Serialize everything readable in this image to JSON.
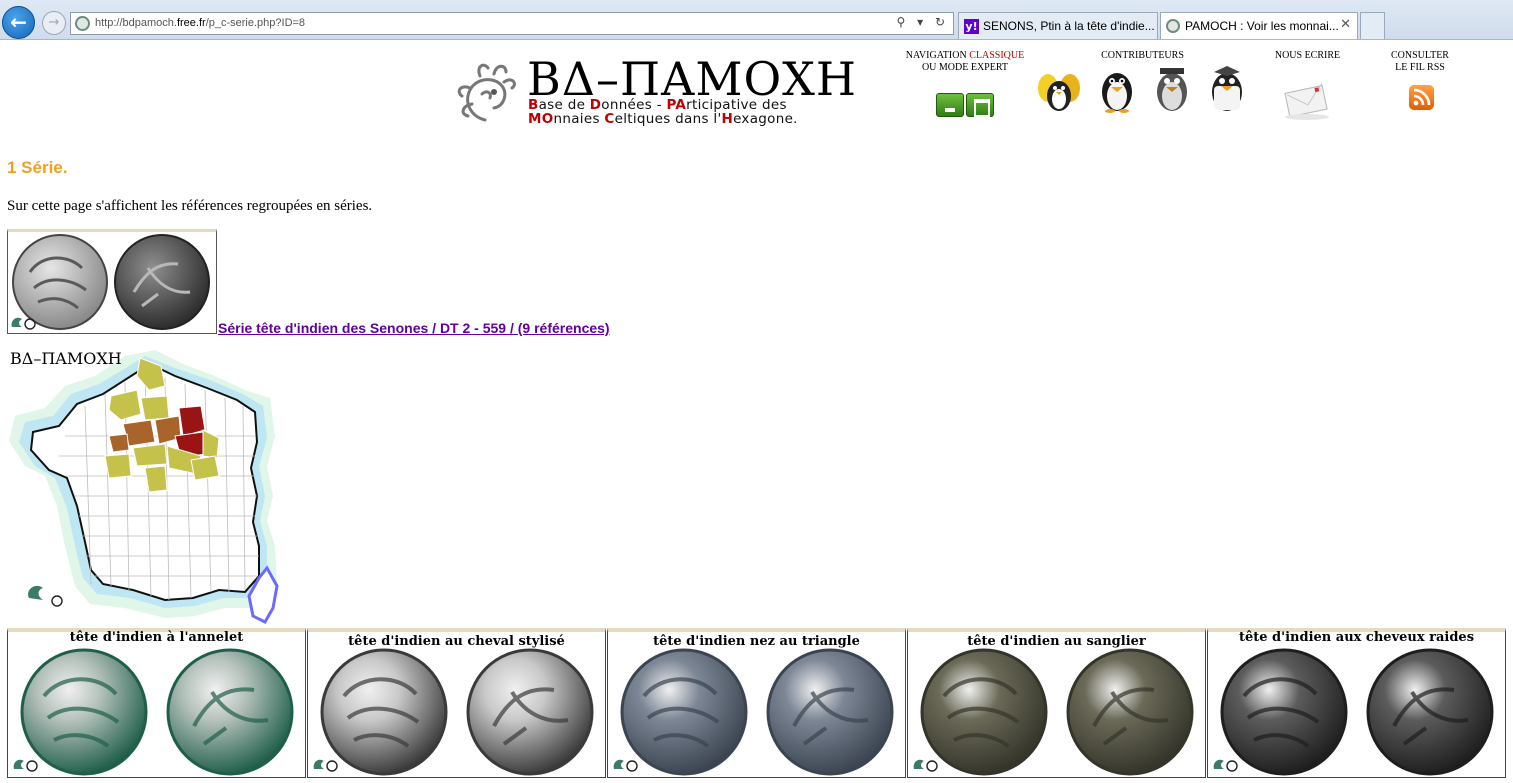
{
  "browser": {
    "url_prefix": "http://bdpamoch.",
    "url_domain": "free.fr",
    "url_path": "/p_c-serie.php?ID=8",
    "address_tools": "⚲ ▾ ↻",
    "tabs": [
      {
        "label": "SENONS, Ptin à la tête d'indie...",
        "active": false
      },
      {
        "label": "PAMOCH : Voir les monnai...",
        "active": true
      }
    ],
    "tab_close": "✕"
  },
  "logo": {
    "title": "ΒΔ–ΠΑΜΟΧΗ",
    "subtitle_line1": [
      {
        "t": "B",
        "red": true
      },
      {
        "t": "ase de ",
        "red": false
      },
      {
        "t": "D",
        "red": true
      },
      {
        "t": "onnées - ",
        "red": false
      },
      {
        "t": "PA",
        "red": true
      },
      {
        "t": "rticipative des",
        "red": false
      }
    ],
    "subtitle_line2": [
      {
        "t": "MO",
        "red": true
      },
      {
        "t": "nnaies ",
        "red": false
      },
      {
        "t": "C",
        "red": true
      },
      {
        "t": "eltiques dans l'",
        "red": false
      },
      {
        "t": "H",
        "red": true
      },
      {
        "t": "exagone.",
        "red": false
      }
    ]
  },
  "header": {
    "nav_prefix": "NAVIGATION ",
    "nav_classic": "CLASSIQUE",
    "nav_line2": "OU MODE EXPERT",
    "contributors": "CONTRIBUTEURS",
    "write_us": "NOUS ECRIRE",
    "rss_line1": "CONSULTER",
    "rss_line2": "LE FIL RSS"
  },
  "page": {
    "title": "1 Série.",
    "intro": "Sur cette page s'affichent les références regroupées en séries.",
    "series_link": "Série tête d'indien des Senones / DT 2 - 559 / (9 références)",
    "map_brand": "ΒΔ–ΠΑΜΟΧΗ"
  },
  "types": [
    {
      "label": "tête d'indien à l'annelet",
      "tone": "#b7c3bd",
      "rim": "#1f5e4a"
    },
    {
      "label": "tête d'indien au cheval stylisé",
      "tone": "#c9c9c9",
      "rim": "#3a3a3a"
    },
    {
      "label": "tête d'indien nez au triangle",
      "tone": "#7d8796",
      "rim": "#3b4450"
    },
    {
      "label": "tête d'indien au sanglier",
      "tone": "#6b6a58",
      "rim": "#34342a"
    },
    {
      "label": "tête d'indien aux cheveux raides",
      "tone": "#5c5c5c",
      "rim": "#1e1e1e"
    }
  ],
  "colors": {
    "title_orange": "#f0a020",
    "link_purple": "#660099",
    "logo_red": "#c00000",
    "map_dark_red": "#9b1414",
    "map_brown": "#a8642a",
    "map_olive": "#c5c24b"
  }
}
